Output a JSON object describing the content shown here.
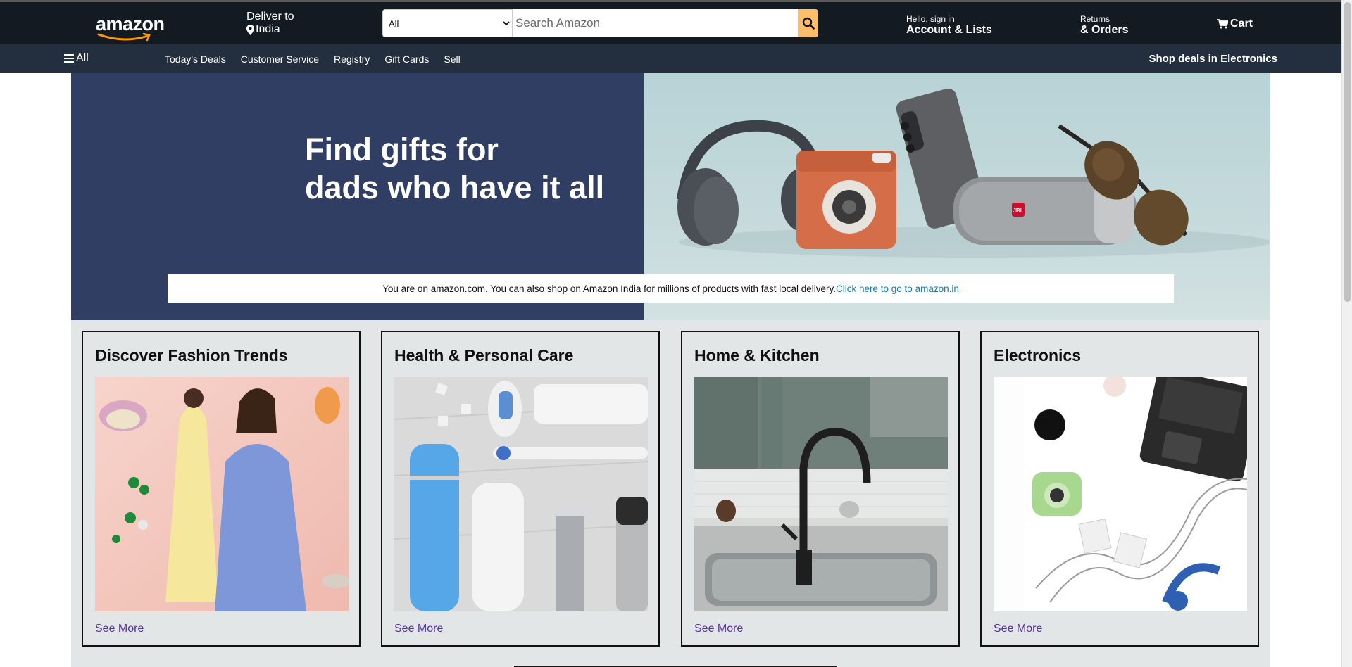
{
  "header": {
    "logo_text": "amazon",
    "deliver_label": "Deliver to",
    "deliver_location": "India",
    "search_category": "All",
    "search_placeholder": "Search Amazon",
    "account_greeting": "Hello, sign in",
    "account_label": "Account & Lists",
    "returns_label": "Returns",
    "orders_label": "& Orders",
    "cart_label": "Cart"
  },
  "nav": {
    "all_label": "All",
    "links": [
      "Today's Deals",
      "Customer Service",
      "Registry",
      "Gift Cards",
      "Sell"
    ],
    "promo": "Shop deals in Electronics"
  },
  "hero": {
    "title_line1": "Find gifts for",
    "title_line2": "dads who have it all",
    "brand_badge": "JBL"
  },
  "notice": {
    "text": "You are on amazon.com. You can also shop on Amazon India for millions of products with fast local delivery.",
    "link_text": "Click here to go to amazon.in"
  },
  "cards": [
    {
      "title": "Discover Fashion Trends",
      "link": "See More"
    },
    {
      "title": "Health & Personal Care",
      "link": "See More"
    },
    {
      "title": "Home & Kitchen",
      "link": "See More"
    },
    {
      "title": "Electronics",
      "link": "See More"
    }
  ],
  "colors": {
    "header_bg": "#131a22",
    "nav_bg": "#232f3e",
    "search_button": "#febd69",
    "hero_left_bg": "#303e63",
    "page_bg": "#e3e6e6",
    "link_color": "#5b2ea5",
    "notice_link": "#1a78a8"
  }
}
